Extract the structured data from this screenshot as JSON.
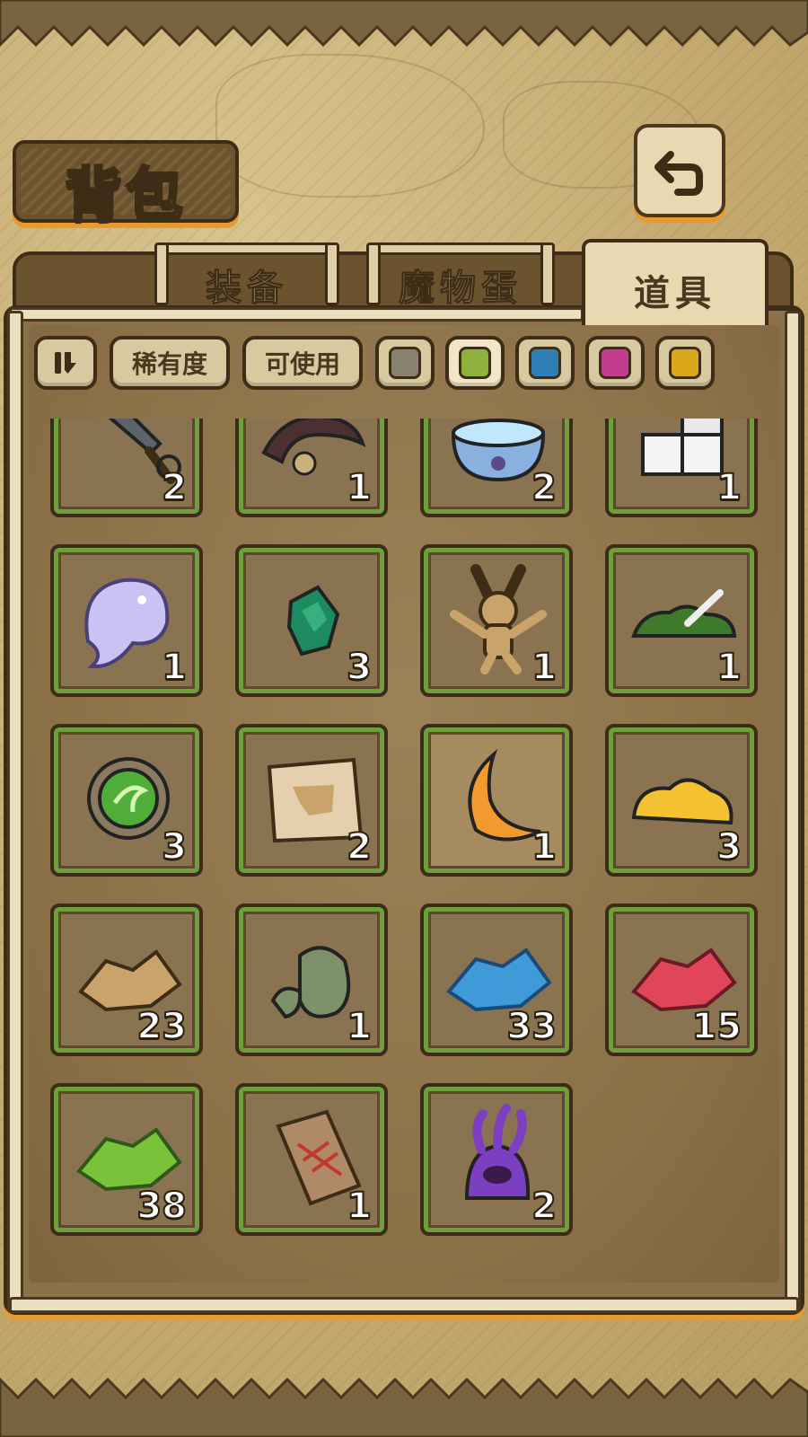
{
  "title": "背包",
  "tabs": [
    {
      "label": "装备",
      "active": false
    },
    {
      "label": "魔物蛋",
      "active": false
    },
    {
      "label": "道具",
      "active": true
    }
  ],
  "filters": {
    "rarity_label": "稀有度",
    "usable_label": "可使用",
    "swatches": [
      "#8a8270",
      "#8fb13e",
      "#2e7fb5",
      "#c23d8e",
      "#d9a81c"
    ]
  },
  "items": [
    {
      "icon": "knife-icon",
      "count": "2"
    },
    {
      "icon": "leather-belt-icon",
      "count": "1"
    },
    {
      "icon": "water-bowl-icon",
      "count": "2"
    },
    {
      "icon": "sugar-cubes-icon",
      "count": "1"
    },
    {
      "icon": "ghost-slime-icon",
      "count": "1"
    },
    {
      "icon": "emerald-gem-icon",
      "count": "3"
    },
    {
      "icon": "voodoo-doll-icon",
      "count": "1"
    },
    {
      "icon": "moss-bone-icon",
      "count": "1"
    },
    {
      "icon": "green-orb-amulet-icon",
      "count": "3"
    },
    {
      "icon": "old-map-scroll-icon",
      "count": "2"
    },
    {
      "icon": "orange-crescent-horn-icon",
      "count": "1"
    },
    {
      "icon": "gold-slime-icon",
      "count": "3"
    },
    {
      "icon": "gold-ore-icon",
      "count": "23"
    },
    {
      "icon": "mossy-rock-icon",
      "count": "1"
    },
    {
      "icon": "blue-crystal-icon",
      "count": "33"
    },
    {
      "icon": "red-crystal-icon",
      "count": "15"
    },
    {
      "icon": "green-crystal-icon",
      "count": "38"
    },
    {
      "icon": "fish-fossil-tablet-icon",
      "count": "1"
    },
    {
      "icon": "purple-tentacle-monster-icon",
      "count": "2"
    }
  ]
}
